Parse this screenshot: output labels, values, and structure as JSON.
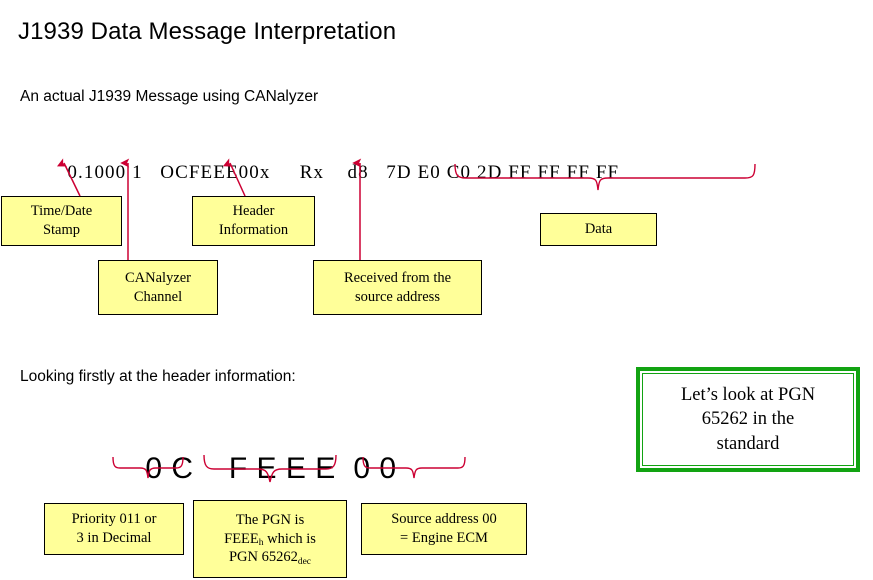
{
  "slide": {
    "title": "J1939 Data Message Interpretation",
    "subtitle": "An actual J1939 Message using CANalyzer",
    "header_lead_in": "Looking firstly at the header information:"
  },
  "message": {
    "timestamp": "0.1000",
    "channel": "1",
    "identifier": "OCFEEE00x",
    "direction": "Rx",
    "dlc": "d8",
    "data_bytes": [
      "7D",
      "E0",
      "C0",
      "2D",
      "FF",
      "FF",
      "FF",
      "FF"
    ],
    "full_line": "0.1000 1  OCFEEE00x    Rx    d8   7D E0 C0 2D FF FF FF FF"
  },
  "callouts": {
    "time_date": {
      "line1": "Time/Date",
      "line2": "Stamp"
    },
    "canalyzer_channel": {
      "line1": "CANalyzer",
      "line2": "Channel"
    },
    "header_information": {
      "line1": "Header",
      "line2": "Information"
    },
    "received_source": {
      "line1": "Received from the",
      "line2": "source address"
    },
    "data": {
      "line1": "Data"
    },
    "priority": {
      "line1": "Priority 011 or",
      "line2": "3 in Decimal"
    },
    "pgn": {
      "line1": "The PGN is",
      "line2_main": "FEEE",
      "line2_sub": "h",
      "line2_tail": "  which is",
      "line3_main": "PGN 65262",
      "line3_sub": "dec"
    },
    "source_address": {
      "line1": "Source address 00",
      "line2": "=  Engine ECM"
    }
  },
  "header_hex": {
    "priority_group": "0 C",
    "pgn_group": "F E E E",
    "source_group": "0 0",
    "full": "0 C    F E E E  0 0"
  },
  "emphasis_box": {
    "line1": "Let’s look at PGN",
    "line2": "65262 in the",
    "line3": "standard"
  },
  "colors": {
    "callout_fill": "#ffff99",
    "callout_border": "#000000",
    "annotation_red": "#cc0033",
    "emphasis_green": "#12a312",
    "background": "#ffffff",
    "text": "#000000"
  }
}
